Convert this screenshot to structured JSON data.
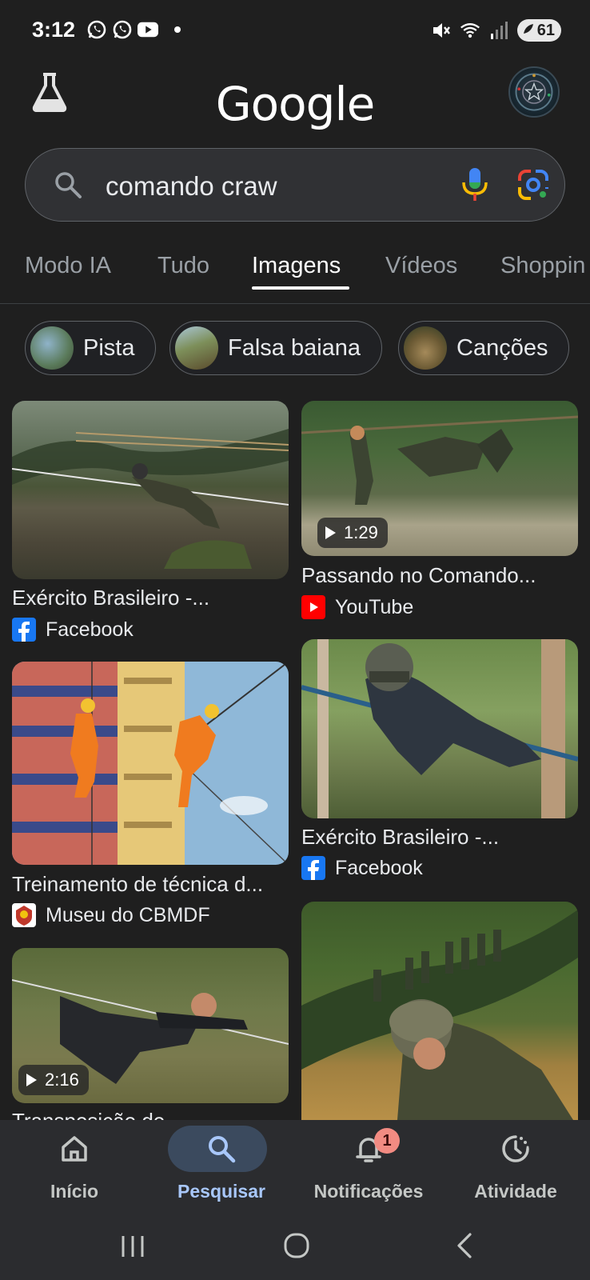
{
  "status_bar": {
    "time": "3:12",
    "battery": "61",
    "icons": [
      "whatsapp-icon",
      "whatsapp-icon",
      "youtube-icon",
      "dot",
      "mute-icon",
      "wifi-icon",
      "signal-icon",
      "battery-icon"
    ]
  },
  "header": {
    "logo": "Google",
    "labs_icon": "flask-icon",
    "avatar": "profile-avatar"
  },
  "search": {
    "query": "comando craw",
    "icons": [
      "search-icon",
      "mic-icon",
      "lens-icon"
    ]
  },
  "tabs": [
    {
      "label": "Modo IA"
    },
    {
      "label": "Tudo"
    },
    {
      "label": "Imagens",
      "active": true
    },
    {
      "label": "Vídeos"
    },
    {
      "label": "Shoppin"
    }
  ],
  "chips": [
    {
      "label": "Pista"
    },
    {
      "label": "Falsa baiana"
    },
    {
      "label": "Canções"
    }
  ],
  "results": [
    {
      "title": "Exército Brasileiro -...",
      "source": "Facebook",
      "source_icon": "facebook-icon"
    },
    {
      "title": "Passando no Comando...",
      "source": "YouTube",
      "source_icon": "youtube-icon",
      "duration": "1:29"
    },
    {
      "title": "Treinamento de técnica d...",
      "source": "Museu do CBMDF",
      "source_icon": "cbmdf-icon"
    },
    {
      "title": "Exército Brasileiro -...",
      "source": "Facebook",
      "source_icon": "facebook-icon"
    },
    {
      "title": "Transposição do",
      "duration": "2:16"
    },
    {
      "title": ""
    }
  ],
  "bottom_nav": [
    {
      "label": "Início",
      "icon": "home-icon"
    },
    {
      "label": "Pesquisar",
      "icon": "search-icon",
      "active": true
    },
    {
      "label": "Notificações",
      "icon": "bell-icon",
      "badge": "1"
    },
    {
      "label": "Atividade",
      "icon": "activity-icon"
    }
  ],
  "system_nav": [
    "recents-icon",
    "home-button-icon",
    "back-icon"
  ],
  "colors": {
    "background": "#1f1f1f",
    "accent": "#a8c7fa",
    "facebook": "#1877f2",
    "youtube": "#ff0000"
  }
}
